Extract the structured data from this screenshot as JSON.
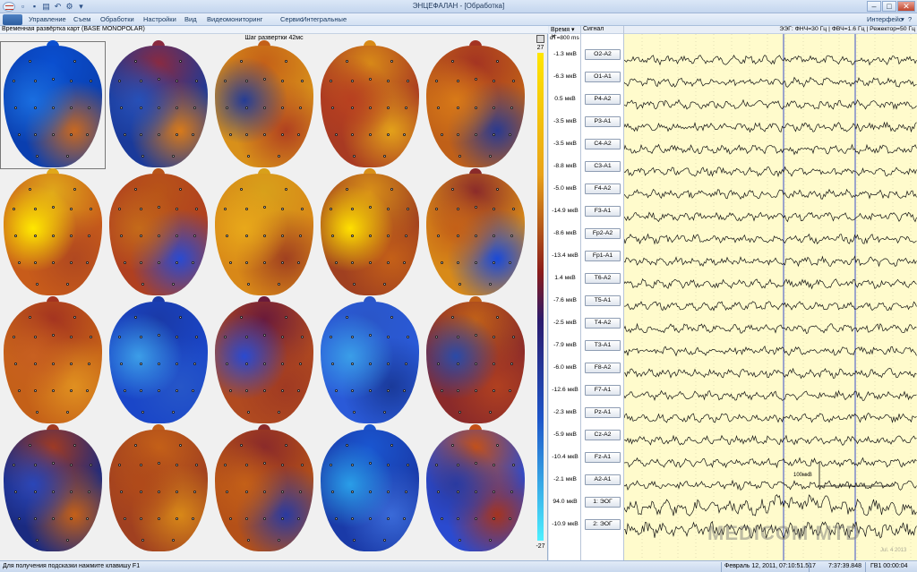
{
  "window": {
    "title": "ЭНЦЕФАЛАН - [Обработка]"
  },
  "menu": {
    "items": [
      "Управление",
      "Съем",
      "Обработки",
      "Настройки",
      "Вид",
      "Видеомониторинг",
      "Сервис",
      "Интегральные"
    ],
    "interface": "Интерфейс"
  },
  "maps_panel": {
    "title": "Временная развёртка карт (BASE MONOPOLAR)",
    "step": "Шаг развертки 42мс",
    "scale_max": "27",
    "scale_min": "-27",
    "heads": [
      {
        "colors": [
          "#0a4fd0",
          "#1a6ee0",
          "#c86820",
          "#0a3fb0"
        ]
      },
      {
        "colors": [
          "#8a2a40",
          "#2650b8",
          "#d87a1a",
          "#1a3a9a"
        ]
      },
      {
        "colors": [
          "#c46018",
          "#243c96",
          "#b04020",
          "#d8901a"
        ]
      },
      {
        "colors": [
          "#d88a18",
          "#b84020",
          "#e3a11a",
          "#a83a22"
        ]
      },
      {
        "colors": [
          "#a43422",
          "#d87a18",
          "#2a3a90",
          "#c06018"
        ]
      },
      {
        "colors": [
          "#e0a81a",
          "#ffe800",
          "#b04820",
          "#c85c1a"
        ]
      },
      {
        "colors": [
          "#b85418",
          "#c46a1a",
          "#2a4ad0",
          "#b04020"
        ]
      },
      {
        "colors": [
          "#d8a01a",
          "#e8a81a",
          "#a04020",
          "#d88818"
        ]
      },
      {
        "colors": [
          "#d89018",
          "#ffe000",
          "#c46018",
          "#a04020"
        ]
      },
      {
        "colors": [
          "#8a2a2a",
          "#c46018",
          "#1a4ad8",
          "#d88a18"
        ]
      },
      {
        "colors": [
          "#a43420",
          "#c86020",
          "#e09020",
          "#c46018"
        ]
      },
      {
        "colors": [
          "#1a3aa8",
          "#3c9ee8",
          "#2656c8",
          "#1a46c8"
        ]
      },
      {
        "colors": [
          "#6a1a3a",
          "#2a4ad0",
          "#a03a22",
          "#b04a20"
        ]
      },
      {
        "colors": [
          "#2a56c8",
          "#3a9ee8",
          "#1a3a9a",
          "#2a5ad8"
        ]
      },
      {
        "colors": [
          "#c06018",
          "#2a4aa8",
          "#b04020",
          "#8a2a2a"
        ]
      },
      {
        "colors": [
          "#a03a22",
          "#2a46b8",
          "#c46018",
          "#1a2a80"
        ]
      },
      {
        "colors": [
          "#c46018",
          "#b04a1a",
          "#d88818",
          "#a04020"
        ]
      },
      {
        "colors": [
          "#8a2a2a",
          "#c46018",
          "#2a3aa0",
          "#b45018"
        ]
      },
      {
        "colors": [
          "#1a56d0",
          "#2a9ee8",
          "#3a6ad8",
          "#1a3aa8"
        ]
      },
      {
        "colors": [
          "#c45018",
          "#2a3aa0",
          "#a43420",
          "#2a4ad0"
        ]
      }
    ]
  },
  "signal_panel": {
    "time_header": "Время",
    "dt": "dT=800 ms",
    "signal_header": "Сигнал",
    "filter_info": "ЭЭГ: ФНЧ=30 Гц | ФВЧ=1.6 Гц | Режектор=50 Гц",
    "scale_label": "100мкВ",
    "channels": [
      {
        "name": "O2-A2",
        "value": "-1.3 мкВ"
      },
      {
        "name": "O1-A1",
        "value": "-6.3 мкВ"
      },
      {
        "name": "P4-A2",
        "value": "0.5 мкВ"
      },
      {
        "name": "P3-A1",
        "value": "-3.5 мкВ"
      },
      {
        "name": "C4-A2",
        "value": "-3.5 мкВ"
      },
      {
        "name": "C3-A1",
        "value": "-8.8 мкВ"
      },
      {
        "name": "F4-A2",
        "value": "-5.0 мкВ"
      },
      {
        "name": "F3-A1",
        "value": "-14.9 мкВ"
      },
      {
        "name": "Fp2-A2",
        "value": "-8.6 мкВ"
      },
      {
        "name": "Fp1-A1",
        "value": "-13.4 мкВ"
      },
      {
        "name": "T6-A2",
        "value": "1.4 мкВ"
      },
      {
        "name": "T5-A1",
        "value": "-7.6 мкВ"
      },
      {
        "name": "T4-A2",
        "value": "-2.5 мкВ"
      },
      {
        "name": "T3-A1",
        "value": "-7.9 мкВ"
      },
      {
        "name": "F8-A2",
        "value": "-6.0 мкВ"
      },
      {
        "name": "F7-A1",
        "value": "-12.6 мкВ"
      },
      {
        "name": "Pz-A1",
        "value": "-2.3 мкВ"
      },
      {
        "name": "Cz-A2",
        "value": "-5.9 мкВ"
      },
      {
        "name": "Fz-A1",
        "value": "-10.4 мкВ"
      },
      {
        "name": "A2-A1",
        "value": "-2.1 мкВ"
      },
      {
        "name": "1: ЭОГ",
        "value": "94.0 мкВ"
      },
      {
        "name": "2: ЭОГ",
        "value": "-10.9 мкВ"
      }
    ]
  },
  "status": {
    "hint": "Для получения подсказки нажмите клавишу F1",
    "date": "Февраль 12, 2011, 07:10:51.517",
    "clock": "7:37:39.848",
    "record": "ГВ1 00:00:04"
  },
  "watermark": {
    "text": "MEDICOM MTD",
    "sub": "Jul. 4 2013"
  }
}
